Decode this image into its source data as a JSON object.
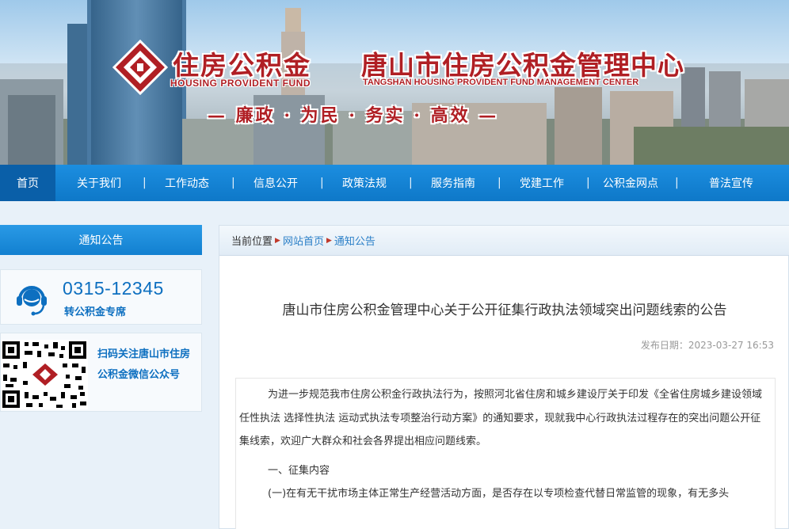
{
  "header": {
    "brand_cn": "住房公积金",
    "brand_en": "HOUSING PROVIDENT FUND",
    "center_cn": "唐山市住房公积金管理中心",
    "center_en": "TANGSHAN HOUSING PROVIDENT FUND MANAGEMENT CENTER",
    "slogan": "— 廉政 · 为民 · 务实 · 高效 —"
  },
  "nav": {
    "items": [
      {
        "label": "首页"
      },
      {
        "label": "关于我们"
      },
      {
        "label": "工作动态"
      },
      {
        "label": "信息公开"
      },
      {
        "label": "政策法规"
      },
      {
        "label": "服务指南"
      },
      {
        "label": "党建工作"
      },
      {
        "label": "公积金网点"
      },
      {
        "label": "普法宣传"
      }
    ],
    "separator": "|"
  },
  "sidebar": {
    "heading": "通知公告",
    "hotline_number": "0315-12345",
    "hotline_sub": "转公积金专席",
    "qr_text": "扫码关注唐山市住房公积金微信公众号"
  },
  "breadcrumb": {
    "label": "当前位置",
    "items": [
      "网站首页",
      "通知公告"
    ]
  },
  "article": {
    "title": "唐山市住房公积金管理中心关于公开征集行政执法领域突出问题线索的公告",
    "date_label": "发布日期：",
    "date": "2023-03-27 16:53",
    "para1": "为进一步规范我市住房公积金行政执法行为，按照河北省住房和城乡建设厅关于印发《全省住房城乡建设领域任性执法 选择性执法 运动式执法专项整治行动方案》的通知要求，现就我中心行政执法过程存在的突出问题公开征集线索，欢迎广大群众和社会各界提出相应问题线索。",
    "section1": "一、征集内容",
    "para2": "(一)在有无干扰市场主体正常生产经营活动方面，是否存在以专项检查代替日常监管的现象，有无多头"
  },
  "colors": {
    "brand_red": "#b01f24",
    "nav_blue": "#0e78c8",
    "link_blue": "#2a7fc7"
  }
}
